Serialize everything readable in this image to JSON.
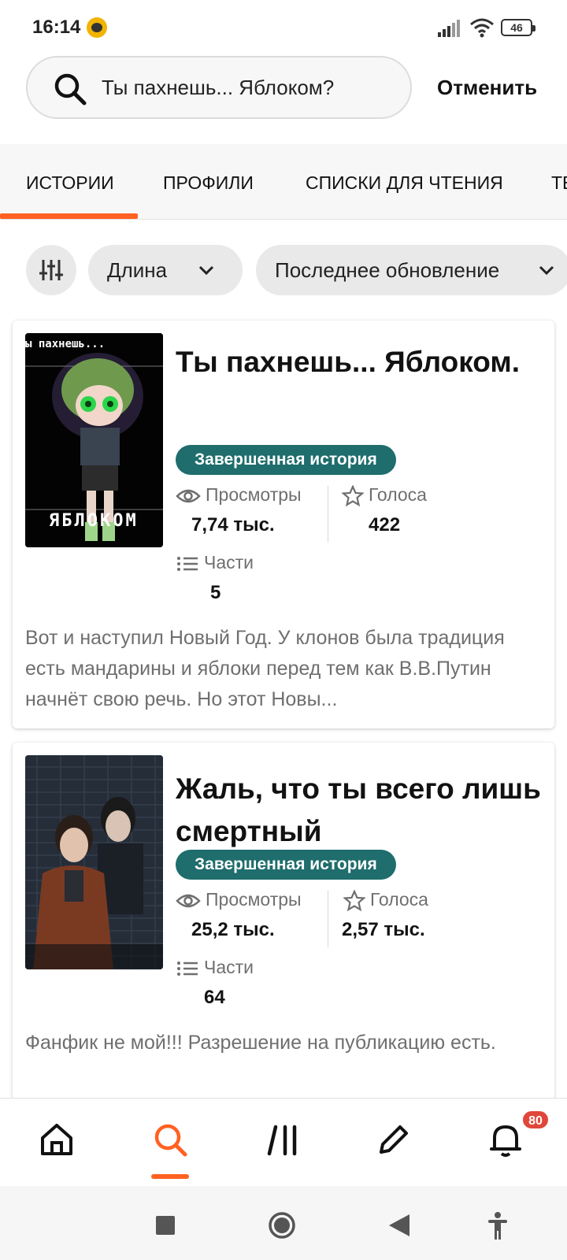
{
  "status_bar": {
    "time": "16:14",
    "battery": "46"
  },
  "search": {
    "query": "Ты пахнешь... Яблоком?",
    "cancel_label": "Отменить"
  },
  "tabs": [
    {
      "label": "ИСТОРИИ",
      "active": true
    },
    {
      "label": "ПРОФИЛИ"
    },
    {
      "label": "СПИСКИ ДЛЯ ЧТЕНИЯ"
    },
    {
      "label": "ТЕ"
    }
  ],
  "filters": {
    "length_label": "Длина",
    "updated_label": "Последнее обновление"
  },
  "results": [
    {
      "title": "Ты пахнешь... Яблоком.",
      "cover_text_top": "ы пахнешь...",
      "cover_text_bottom": "ЯБЛОКОМ",
      "status": "Завершенная история",
      "views_label": "Просмотры",
      "views_value": "7,74 тыс.",
      "votes_label": "Голоса",
      "votes_value": "422",
      "parts_label": "Части",
      "parts_value": "5",
      "description": "Вот и наступил Новый Год. У клонов была традиция есть мандарины и яблоки перед тем как В.В.Путин начнёт свою речь. Но этот Новы..."
    },
    {
      "title": "Жаль, что ты всего лишь смертный",
      "status": "Завершенная история",
      "views_label": "Просмотры",
      "views_value": "25,2 тыс.",
      "votes_label": "Голоса",
      "votes_value": "2,57 тыс.",
      "parts_label": "Части",
      "parts_value": "64",
      "description": "Фанфик не мой!!! Разрешение на публикацию есть."
    }
  ],
  "bottom_nav": {
    "items": [
      "home-icon",
      "search-icon",
      "library-icon",
      "write-icon",
      "notifications-icon"
    ],
    "notification_count": "80"
  },
  "colors": {
    "accent": "#ff6122",
    "badge_teal": "#1f6d6d",
    "notification_red": "#e0463a"
  }
}
